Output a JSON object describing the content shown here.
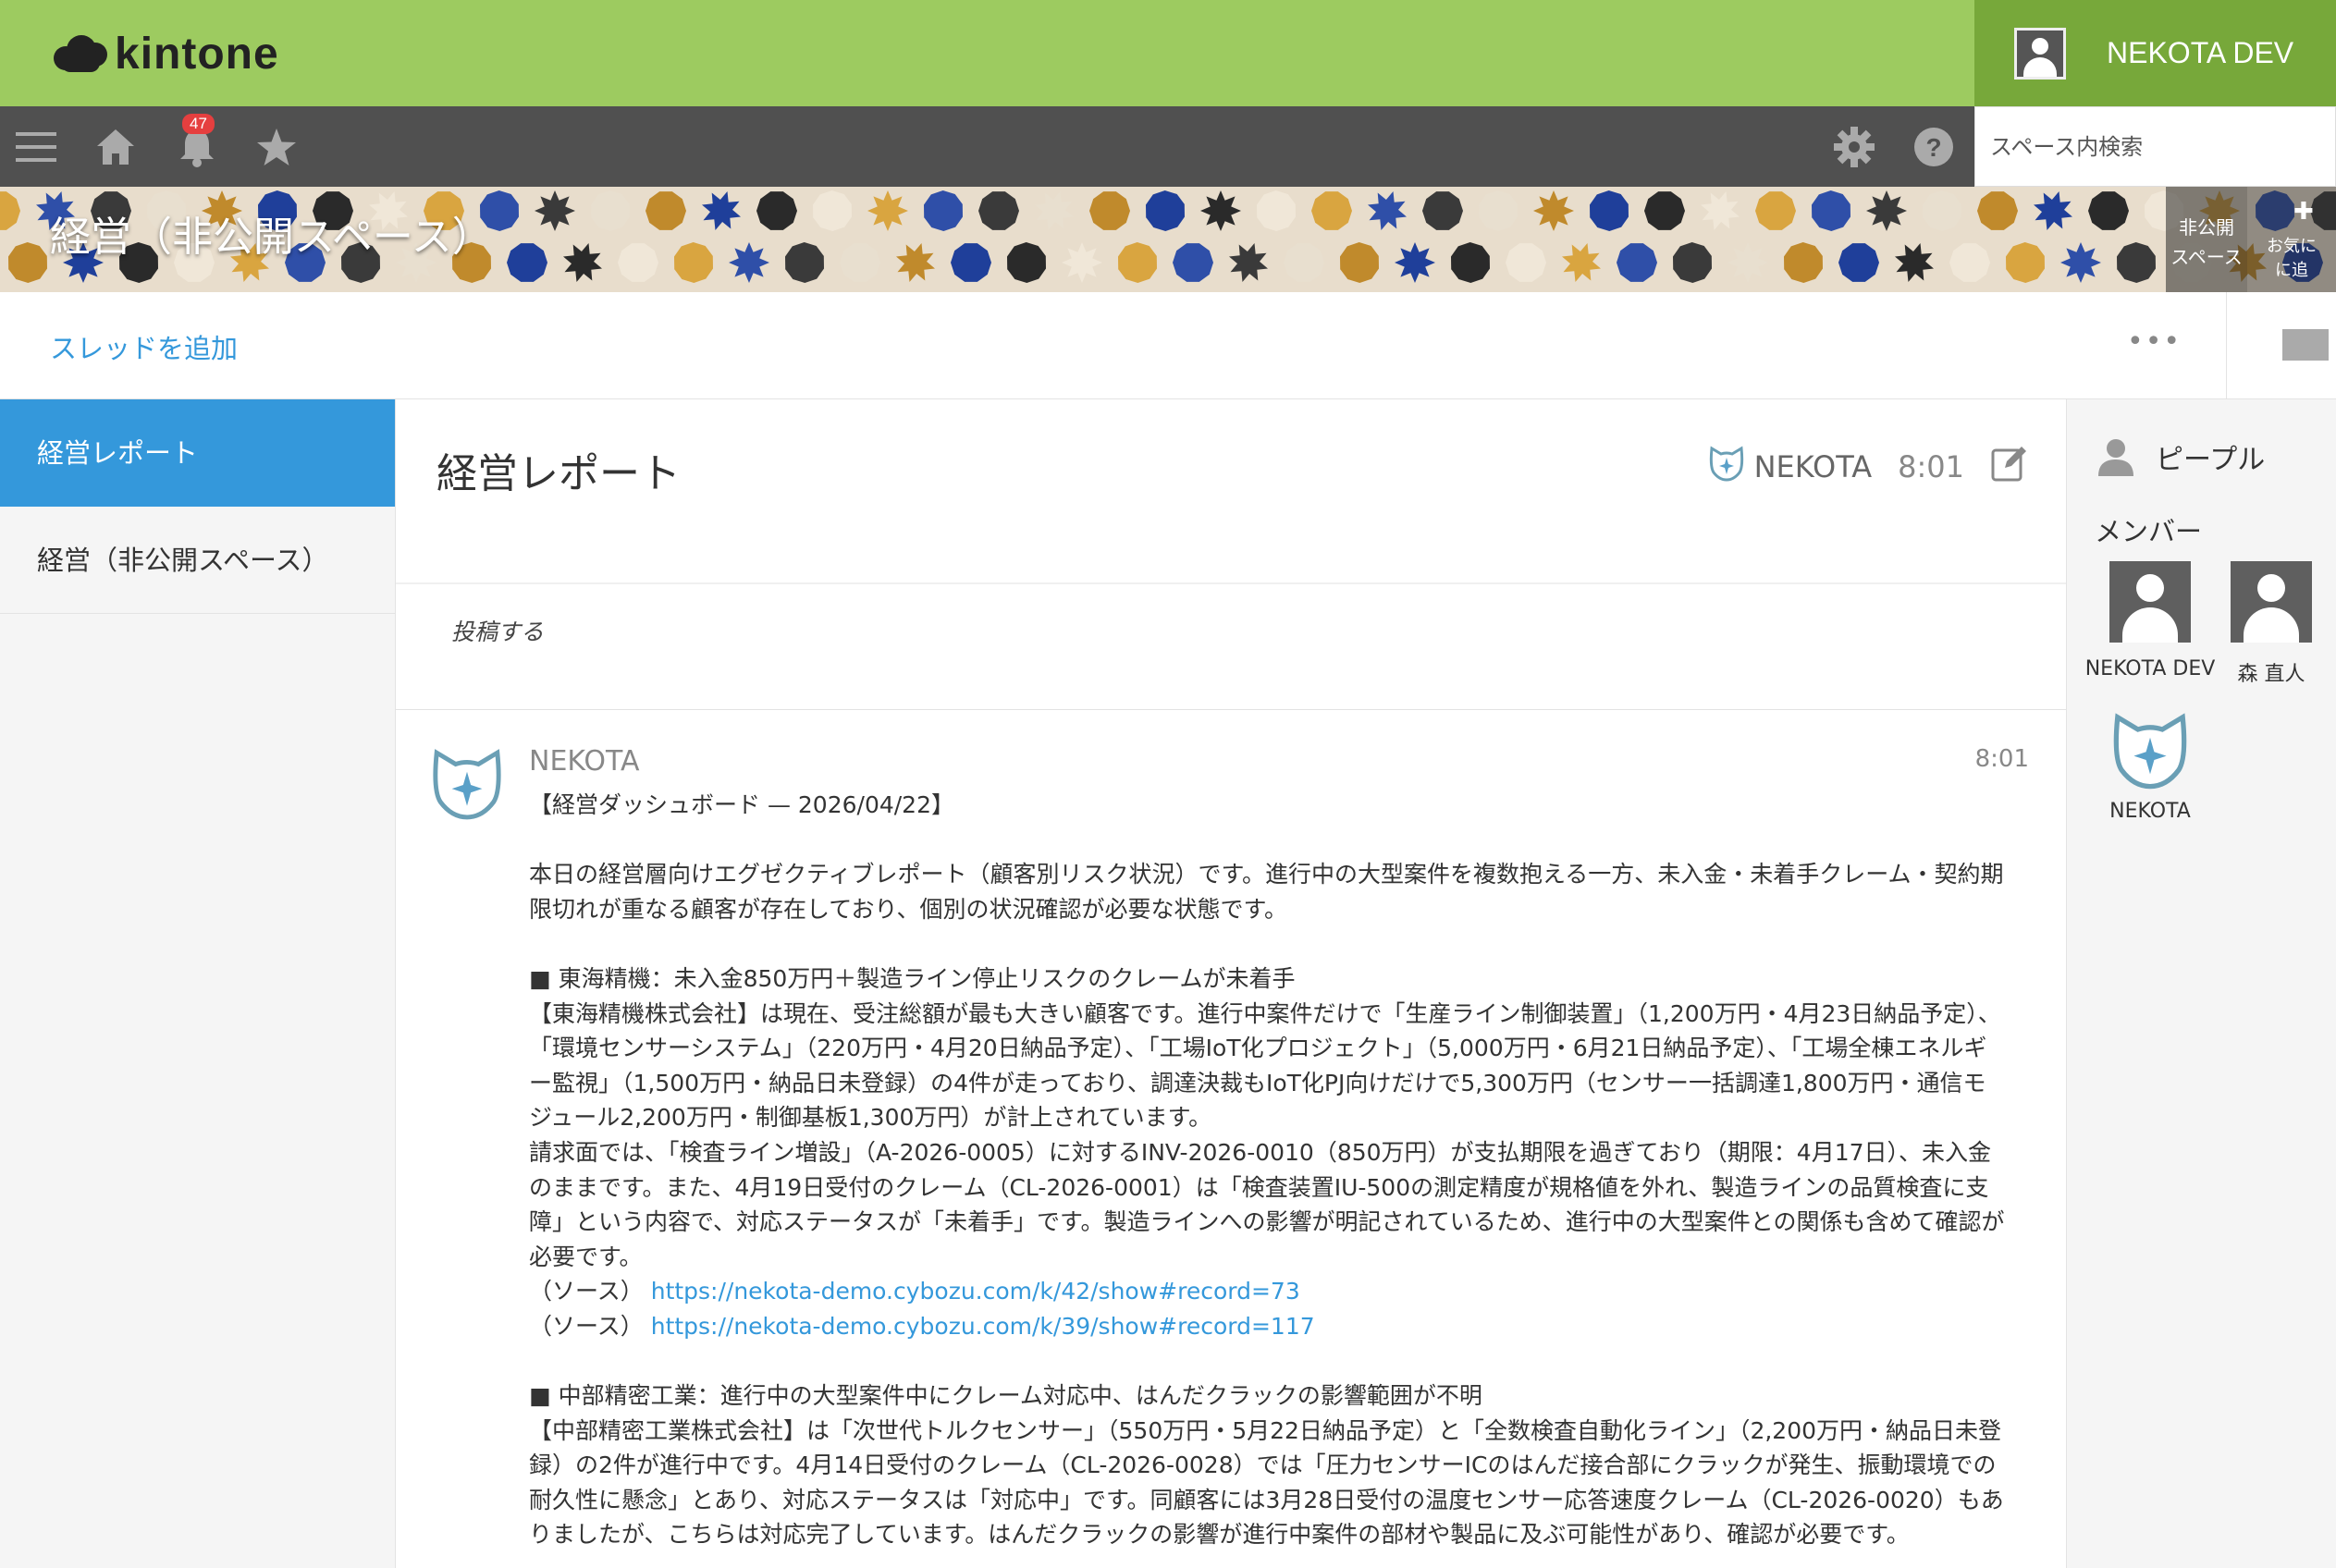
{
  "app": {
    "logo_text": "kintone"
  },
  "user": {
    "name": "NEKOTA DEV"
  },
  "nav": {
    "notification_count": "47",
    "search_placeholder": "スペース内検索"
  },
  "space": {
    "title": "経営（非公開スペース）",
    "private_badge": "非公開\nスペース",
    "favorite_label": "お気に\nに追"
  },
  "toolbar": {
    "add_thread": "スレッドを追加",
    "more": "•••"
  },
  "sidebar": {
    "items": [
      {
        "label": "経営レポート",
        "active": true
      },
      {
        "label": "経営（非公開スペース）",
        "active": false
      }
    ]
  },
  "thread": {
    "title": "経営レポート",
    "author": "NEKOTA",
    "time": "8:01",
    "post_placeholder": "投稿する"
  },
  "comment": {
    "author": "NEKOTA",
    "time": "8:01",
    "lines": {
      "l1": "【経営ダッシュボード — 2026/04/22】",
      "l2": "本日の経営層向けエグゼクティブレポート（顧客別リスク状況）です。進行中の大型案件を複数抱える一方、未入金・未着手クレーム・契約期限切れが重なる顧客が存在しており、個別の状況確認が必要な状態です。",
      "l3": "■ 東海精機：未入金850万円＋製造ライン停止リスクのクレームが未着手",
      "l4": "【東海精機株式会社】は現在、受注総額が最も大きい顧客です。進行中案件だけで「生産ライン制御装置」（1,200万円・4月23日納品予定）、「環境センサーシステム」（220万円・4月20日納品予定）、「工場IoT化プロジェクト」（5,000万円・6月21日納品予定）、「工場全棟エネルギー監視」（1,500万円・納品日未登録）の4件が走っており、調達決裁もIoT化PJ向けだけで5,300万円（センサー一括調達1,800万円・通信モジュール2,200万円・制御基板1,300万円）が計上されています。",
      "l5": "請求面では、「検査ライン増設」（A-2026-0005）に対するINV-2026-0010（850万円）が支払期限を過ぎており（期限：4月17日）、未入金のままです。また、4月19日受付のクレーム（CL-2026-0001）は「検査装置IU-500の測定精度が規格値を外れ、製造ラインの品質検査に支障」という内容で、対応ステータスが「未着手」です。製造ラインへの影響が明記されているため、進行中の大型案件との関係も含めて確認が必要です。",
      "src_label": "（ソース）",
      "src1": "https://nekota-demo.cybozu.com/k/42/show#record=73",
      "src2": "https://nekota-demo.cybozu.com/k/39/show#record=117",
      "l6": "■ 中部精密工業：進行中の大型案件中にクレーム対応中、はんだクラックの影響範囲が不明",
      "l7": "【中部精密工業株式会社】は「次世代トルクセンサー」（550万円・5月22日納品予定）と「全数検査自動化ライン」（2,200万円・納品日未登録）の2件が進行中です。4月14日受付のクレーム（CL-2026-0028）では「圧力センサーICのはんだ接合部にクラックが発生、振動環境での耐久性に懸念」とあり、対応ステータスは「対応中」です。同顧客には3月28日受付の温度センサー応答速度クレーム（CL-2026-0020）もありましたが、こちらは対応完了しています。はんだクラックの影響が進行中案件の部材や製品に及ぶ可能性があり、確認が必要です。"
    }
  },
  "people": {
    "header": "ピープル",
    "members_label": "メンバー",
    "members": [
      {
        "name": "NEKOTA DEV",
        "icon": "person-icon"
      },
      {
        "name": "森 直人",
        "icon": "person-icon"
      },
      {
        "name": "NEKOTA",
        "icon": "nekota-logo-icon"
      }
    ]
  },
  "colors": {
    "header_green": "#9dcb60",
    "user_green": "#77a83a",
    "nav_dark": "#505050",
    "accent_blue": "#3498db"
  }
}
